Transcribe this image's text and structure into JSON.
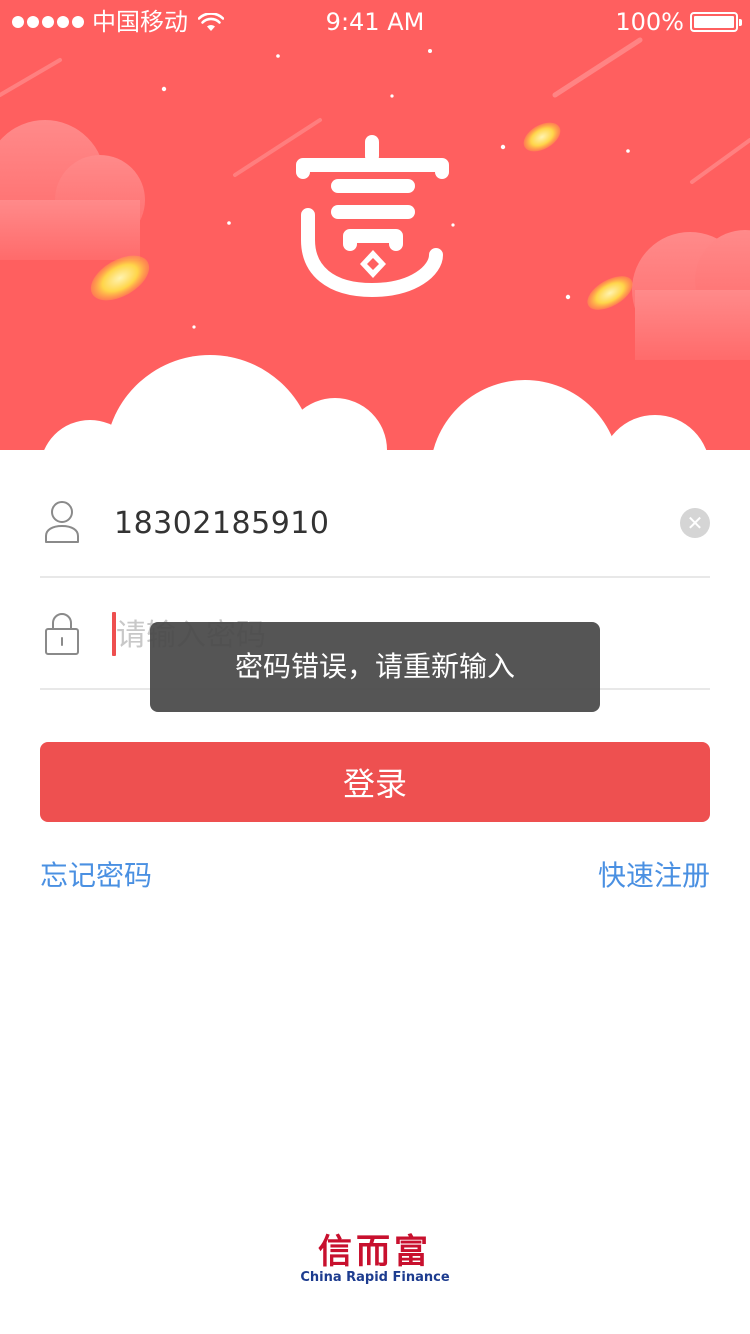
{
  "status_bar": {
    "carrier": "中国移动",
    "time": "9:41 AM",
    "battery": "100%"
  },
  "hero": {
    "logo_icon": "fortune-pot-logo-icon",
    "colors": {
      "background": "#ff5f5f",
      "coin": "#ffd54a"
    }
  },
  "form": {
    "phone_value": "18302185910",
    "password_placeholder": "请输入密码",
    "login_label": "登录",
    "forgot_label": "忘记密码",
    "register_label": "快速注册"
  },
  "toast": {
    "message": "密码错误，请重新输入"
  },
  "footer": {
    "brand_cn": "信而富",
    "brand_en": "China Rapid Finance"
  },
  "colors": {
    "accent": "#ee5050",
    "link": "#4a90e2",
    "brand_red": "#c8102e",
    "brand_blue": "#1d3c8f"
  }
}
